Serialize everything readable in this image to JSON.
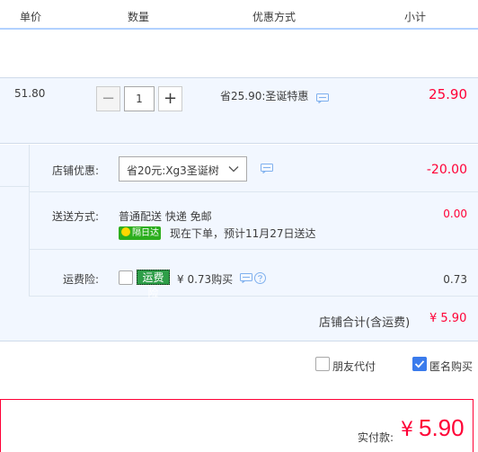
{
  "header": {
    "col_price": "单价",
    "col_qty": "数量",
    "col_promo": "优惠方式",
    "col_subtotal": "小计"
  },
  "item": {
    "price": "51.80",
    "quantity": "1",
    "minus": "−",
    "plus": "+",
    "promo": "省25.90:圣诞特惠",
    "subtotal": "25.90"
  },
  "shop": {
    "discount_label": "店铺优惠:",
    "discount_selected": "省20元:Xg3圣诞树",
    "discount_value": "-20.00",
    "shipping_label": "送送方式:",
    "shipping_method": "普通配送 快递 免邮",
    "shipping_badge": "隔日达",
    "shipping_eta": "现在下单，预计11月27日送达",
    "shipping_value": "0.00",
    "insurance_label": "运费险:",
    "insurance_badge": "运费险",
    "insurance_price": "¥ 0.73购买",
    "insurance_value": "0.73",
    "total_label": "店铺合计(含运费)",
    "total_value": "¥ 5.90"
  },
  "options": {
    "friend_pay": "朋友代付",
    "anonymous": "匿名购买"
  },
  "payment": {
    "label": "实付款:",
    "yen": "¥",
    "amount": "5.90"
  },
  "colors": {
    "accent_red": "#ff0036",
    "accent_blue": "#3a7bec",
    "green_badge": "#2cae1e"
  },
  "icons": [
    "message-icon",
    "chevron-down-icon",
    "help-icon",
    "lightning-icon"
  ]
}
